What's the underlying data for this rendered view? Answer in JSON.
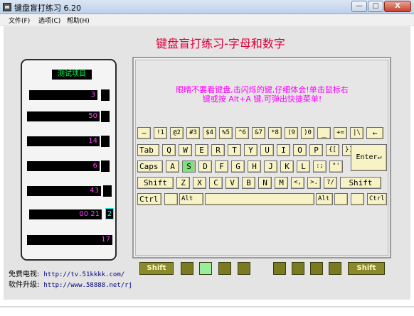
{
  "window": {
    "title": "键盘盲打练习 6.20",
    "min_label": "—",
    "max_label": "□",
    "close_label": "X"
  },
  "menu": {
    "items": [
      "文件(F)",
      "选项(C)",
      "帮助(H)"
    ]
  },
  "heading": "键盘盲打练习-字母和数字",
  "stats_panel": {
    "title": "测试项目",
    "values": [
      "3",
      "50",
      "14",
      "6",
      "43",
      "00 21",
      "2",
      "17"
    ]
  },
  "instructions": {
    "line1": "眼睛不要看键盘,击闪烁的键,仔细体会!单击鼠标右",
    "line2": "键或按 Alt+A 键,可弹出快捷菜单!"
  },
  "keyboard": {
    "active_key": "S",
    "row1": [
      "~",
      "!1",
      "@2",
      "#3",
      "$4",
      "%5",
      "^6",
      "&7",
      "*8",
      "(9",
      ")0",
      "_",
      "+=",
      "|\\",
      "←"
    ],
    "row2": [
      "Tab",
      "Q",
      "W",
      "E",
      "R",
      "T",
      "Y",
      "U",
      "I",
      "O",
      "P",
      "{[",
      "}]"
    ],
    "row3": [
      "Caps",
      "A",
      "S",
      "D",
      "F",
      "G",
      "H",
      "J",
      "K",
      "L",
      ":;",
      "\"'"
    ],
    "enter": "Enter↵",
    "row4": [
      "Shift",
      "Z",
      "X",
      "C",
      "V",
      "B",
      "N",
      "M",
      "<,",
      ">.",
      "?/",
      "Shift"
    ],
    "row5": [
      "Ctrl",
      "",
      "Alt",
      "",
      "Alt",
      "",
      "",
      "Ctrl"
    ]
  },
  "fingers": {
    "left_shift": "Shift",
    "right_shift": "Shift",
    "active_finger_index": 1
  },
  "footer": {
    "free_label": "免费电视:",
    "free_url": "http://tv.51kkkk.com/",
    "upgrade_label": "软件升级:",
    "upgrade_url": "http://www.58888.net/rj"
  }
}
